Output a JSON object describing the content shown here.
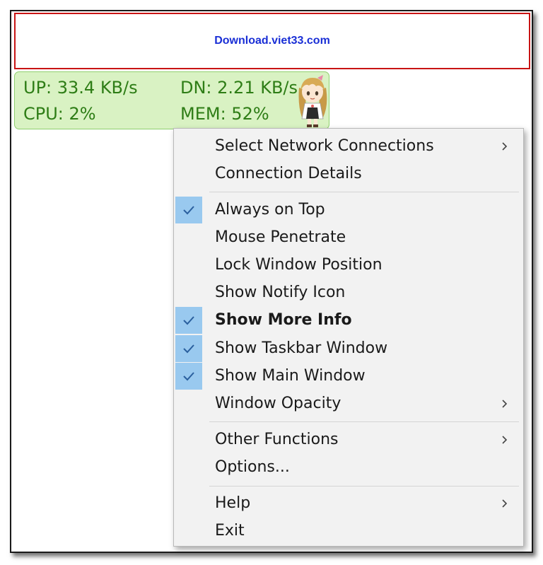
{
  "banner": {
    "text": "Download.viet33.com"
  },
  "monitor": {
    "up": "UP: 33.4 KB/s",
    "dn": "DN: 2.21 KB/s",
    "cpu": "CPU: 2%",
    "mem": "MEM: 52%",
    "colors": {
      "text": "#2e7d16",
      "background": "#d9f2c3",
      "border": "#8fcf6e"
    },
    "mascot_icon": "anime-girl-mascot-icon"
  },
  "menu": {
    "check_color": "#99c9ef",
    "items": [
      {
        "label": "Select Network Connections",
        "submenu": true,
        "checked": false
      },
      {
        "label": "Connection Details",
        "submenu": false,
        "checked": false
      },
      {
        "label": "Always on Top",
        "submenu": false,
        "checked": true
      },
      {
        "label": "Mouse Penetrate",
        "submenu": false,
        "checked": false
      },
      {
        "label": "Lock Window Position",
        "submenu": false,
        "checked": false
      },
      {
        "label": "Show Notify Icon",
        "submenu": false,
        "checked": false
      },
      {
        "label": "Show More Info",
        "submenu": false,
        "checked": true,
        "bold": true
      },
      {
        "label": "Show Taskbar Window",
        "submenu": false,
        "checked": true
      },
      {
        "label": "Show Main Window",
        "submenu": false,
        "checked": true
      },
      {
        "label": "Window Opacity",
        "submenu": true,
        "checked": false
      },
      {
        "label": "Other Functions",
        "submenu": true,
        "checked": false
      },
      {
        "label": "Options...",
        "submenu": false,
        "checked": false
      },
      {
        "label": "Help",
        "submenu": true,
        "checked": false
      },
      {
        "label": "Exit",
        "submenu": false,
        "checked": false
      }
    ]
  }
}
